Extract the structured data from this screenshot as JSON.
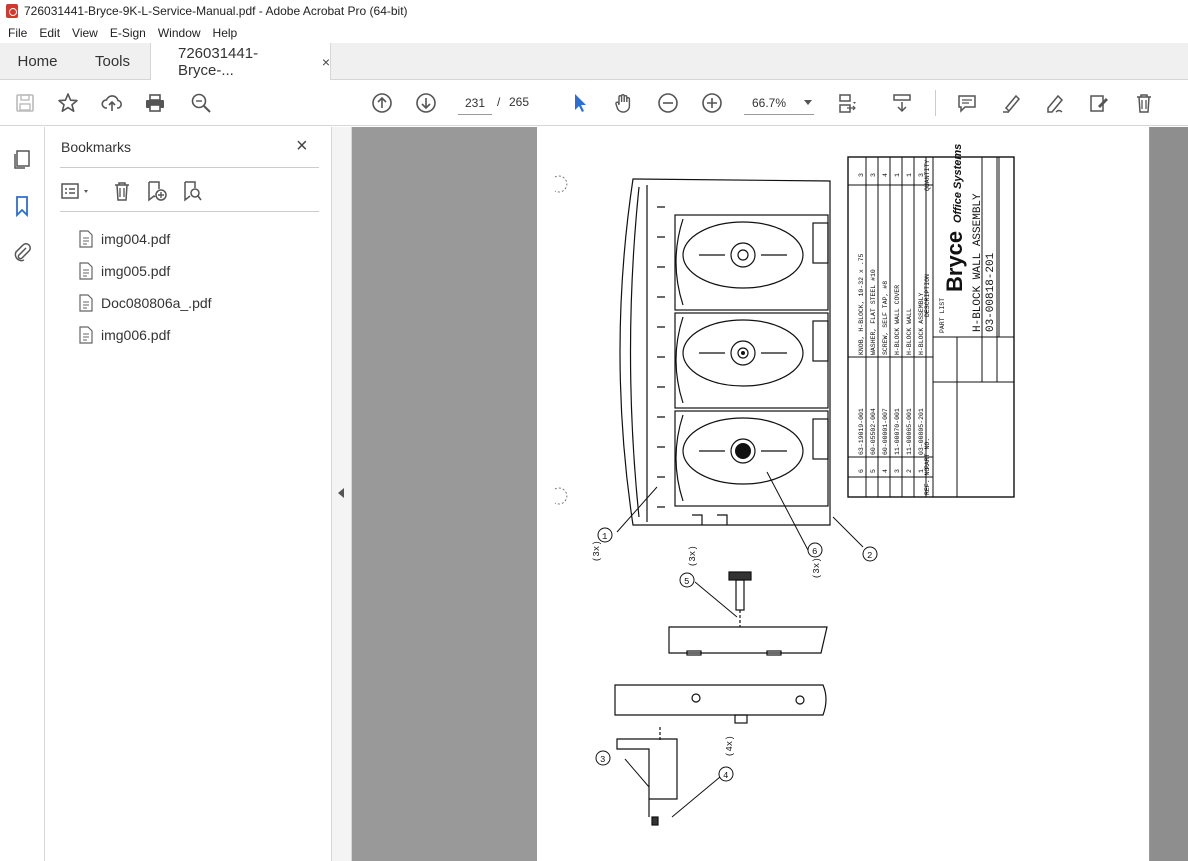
{
  "window": {
    "title": "726031441-Bryce-9K-L-Service-Manual.pdf - Adobe Acrobat Pro (64-bit)"
  },
  "menu": [
    "File",
    "Edit",
    "View",
    "E-Sign",
    "Window",
    "Help"
  ],
  "tabs": {
    "home": "Home",
    "tools": "Tools",
    "document": "726031441-Bryce-...",
    "document_close": "×"
  },
  "toolbar": {
    "current_page": "231",
    "page_separator": "/",
    "total_pages": "265",
    "zoom": "66.7%",
    "icons": [
      "save-icon",
      "star-icon",
      "upload-icon",
      "print-icon",
      "find-icon",
      "prev-page-icon",
      "next-page-icon",
      "select-cursor-icon",
      "hand-icon",
      "zoom-out-icon",
      "zoom-in-icon",
      "page-display-icon",
      "scroll-icon",
      "comment-icon",
      "highlight-icon",
      "sign-icon",
      "edit-icon",
      "delete-icon"
    ]
  },
  "bookmarks": {
    "title": "Bookmarks",
    "close": "×",
    "items": [
      "img004.pdf",
      "img005.pdf",
      "Doc080806a_.pdf",
      "img006.pdf"
    ]
  },
  "drawing": {
    "brand": "Bryce",
    "brand_sub": "Office Systems",
    "assembly_title": "H-BLOCK WALL ASSEMBLY",
    "part_no": "03-00818-201",
    "part_list_label": "PART LIST",
    "description_label": "DESCRIPTION",
    "quantity_label": "QUANTITY",
    "ref_label": "REF. NO.",
    "partno_label": "PART NO.",
    "parts": [
      {
        "ref": "6",
        "part": "63-19019-001",
        "desc": "KNOB, H-BLOCK, 10-32 x .75",
        "qty": "3"
      },
      {
        "ref": "5",
        "part": "60-05502-004",
        "desc": "WASHER, FLAT STEEL #10",
        "qty": "3"
      },
      {
        "ref": "4",
        "part": "60-00001-007",
        "desc": "SCREW, SELF TAP, #8",
        "qty": "4"
      },
      {
        "ref": "3",
        "part": "11-00070-001",
        "desc": "H-BLOCK WALL COVER",
        "qty": "1"
      },
      {
        "ref": "2",
        "part": "11-00065-001",
        "desc": "H-BLOCK WALL",
        "qty": "1"
      },
      {
        "ref": "1",
        "part": "03-00805-201",
        "desc": "H-BLOCK ASSEMBLY",
        "qty": "3"
      }
    ],
    "callouts": [
      "(3x) 1",
      "2",
      "(3x) 6",
      "5 (3x)",
      "3",
      "4 (4x)"
    ]
  }
}
